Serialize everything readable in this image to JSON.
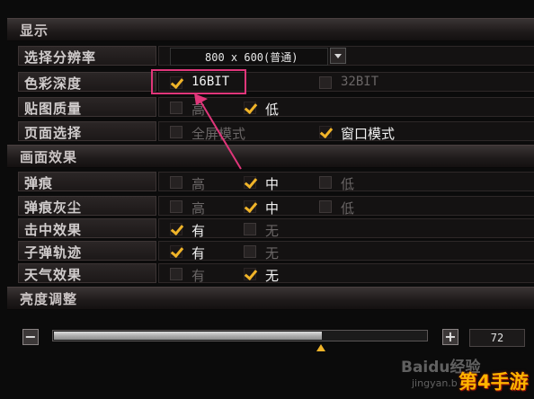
{
  "sections": {
    "display": "显示",
    "effects": "画面效果",
    "brightness": "亮度调整"
  },
  "display": {
    "resolution": {
      "label": "选择分辨率",
      "value": "800 x 600(普通)"
    },
    "color_depth": {
      "label": "色彩深度",
      "opt1": "16BIT",
      "opt2": "32BIT"
    },
    "texture_quality": {
      "label": "贴图质量",
      "opt_high": "高",
      "opt_low": "低"
    },
    "page_mode": {
      "label": "页面选择",
      "opt_full": "全屏模式",
      "opt_window": "窗口模式"
    }
  },
  "effects": {
    "bullet_hole": {
      "label": "弹痕",
      "high": "高",
      "mid": "中",
      "low": "低"
    },
    "bullet_dust": {
      "label": "弹痕灰尘",
      "high": "高",
      "mid": "中",
      "low": "低"
    },
    "hit_effect": {
      "label": "击中效果",
      "yes": "有",
      "no": "无"
    },
    "bullet_trail": {
      "label": "子弹轨迹",
      "yes": "有",
      "no": "无"
    },
    "weather_effect": {
      "label": "天气效果",
      "yes": "有",
      "no": "无"
    }
  },
  "brightness": {
    "minus": "−",
    "plus": "+",
    "value": "72",
    "level_percent": 72
  },
  "watermark": {
    "brand": "Baidu经验",
    "url": "jingyan.b",
    "site_logo": "第4手游"
  },
  "colors": {
    "accent": "#f0b429",
    "highlight": "#e0367a"
  }
}
